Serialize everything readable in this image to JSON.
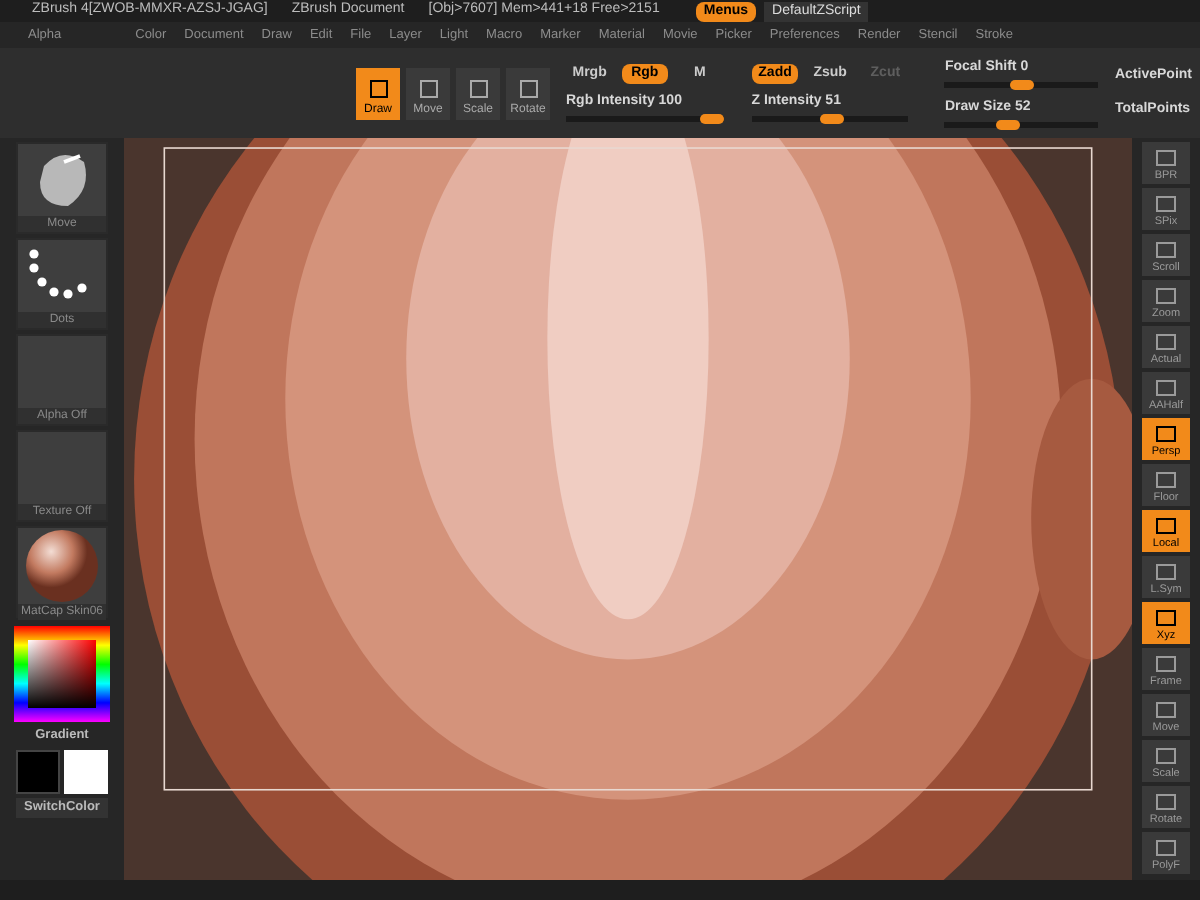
{
  "title_bar": {
    "title": "ZBrush 4[ZWOB-MMXR-AZSJ-JGAG]",
    "document": "ZBrush Document",
    "info": "[Obj>7607] Mem>441+18 Free>2151",
    "buttons": [
      {
        "label": "Menus",
        "selected": true
      },
      {
        "label": "DefaultZScript",
        "selected": false
      }
    ]
  },
  "menu_bar": [
    "Alpha",
    "Color",
    "Document",
    "Draw",
    "Edit",
    "File",
    "Layer",
    "Light",
    "Macro",
    "Marker",
    "Material",
    "Movie",
    "Picker",
    "Preferences",
    "Render",
    "Stencil",
    "Stroke"
  ],
  "toolbar": {
    "modes": [
      {
        "label": "Draw",
        "selected": true
      },
      {
        "label": "Move",
        "selected": false
      },
      {
        "label": "Scale",
        "selected": false
      },
      {
        "label": "Rotate",
        "selected": false
      }
    ],
    "toggles": [
      {
        "label": "Mrgb",
        "selected": false,
        "disabled": false
      },
      {
        "label": "Rgb",
        "selected": true,
        "disabled": false
      },
      {
        "label": "M",
        "selected": false,
        "disabled": false
      },
      {
        "label": "Zadd",
        "selected": true,
        "disabled": false
      },
      {
        "label": "Zsub",
        "selected": false,
        "disabled": false
      },
      {
        "label": "Zcut",
        "selected": false,
        "disabled": true
      }
    ],
    "sliders": [
      {
        "label": "Rgb Intensity 100",
        "level": 1
      },
      {
        "label": "Z Intensity 51",
        "level": 0.51
      },
      {
        "label": "Focal Shift 0",
        "level": 0.5
      },
      {
        "label": "Draw Size 52",
        "level": 0.4
      }
    ],
    "stats": [
      "ActivePoint",
      "TotalPoints"
    ]
  },
  "left_shelf": [
    {
      "kind": "brush",
      "label": "Move"
    },
    {
      "kind": "stroke",
      "label": "Dots"
    },
    {
      "kind": "empty",
      "label": "Alpha Off"
    },
    {
      "kind": "empty",
      "label": "Texture Off"
    },
    {
      "kind": "material",
      "label": "MatCap Skin06"
    }
  ],
  "color_picker": {
    "label": "Gradient",
    "switch_label": "SwitchColor"
  },
  "right_shelf": [
    {
      "label": "BPR",
      "selected": false
    },
    {
      "label": "SPix",
      "selected": false
    },
    {
      "label": "Scroll",
      "selected": false
    },
    {
      "label": "Zoom",
      "selected": false
    },
    {
      "label": "Actual",
      "selected": false
    },
    {
      "label": "AAHalf",
      "selected": false
    },
    {
      "label": "Persp",
      "selected": true
    },
    {
      "label": "Floor",
      "selected": false
    },
    {
      "label": "Local",
      "selected": true
    },
    {
      "label": "L.Sym",
      "selected": false
    },
    {
      "label": "Xyz",
      "selected": true
    },
    {
      "label": "Frame",
      "selected": false
    },
    {
      "label": "Move",
      "selected": false
    },
    {
      "label": "Scale",
      "selected": false
    },
    {
      "label": "Rotate",
      "selected": false
    },
    {
      "label": "PolyF",
      "selected": false
    }
  ]
}
